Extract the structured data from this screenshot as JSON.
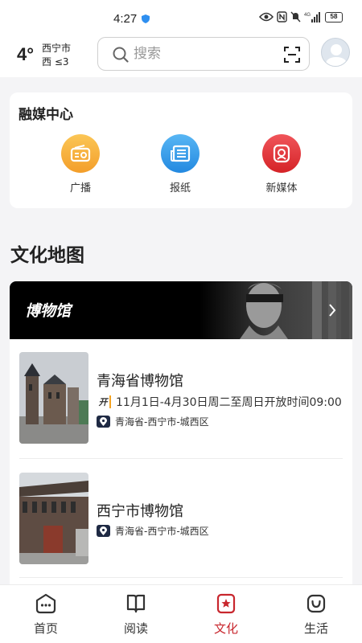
{
  "status_bar": {
    "time": "4:27",
    "battery": "58",
    "network": "4G"
  },
  "header": {
    "temperature": "4°",
    "city": "西宁市",
    "wind": "西 ≤3",
    "search_placeholder": "搜索"
  },
  "media_center": {
    "title": "融媒中心",
    "items": [
      {
        "label": "广播",
        "icon": "radio-icon",
        "color": "#f7b23b"
      },
      {
        "label": "报纸",
        "icon": "newspaper-icon",
        "color": "#2f9be8"
      },
      {
        "label": "新媒体",
        "icon": "new-media-icon",
        "color": "#e23b3b"
      }
    ]
  },
  "culture_map": {
    "title": "文化地图",
    "banner_title": "博物馆",
    "museums": [
      {
        "name": "青海省博物馆",
        "open_badge": "开",
        "hours": "11月1日-4月30日周二至周日开放时间09:00",
        "location": "青海省-西宁市-城西区"
      },
      {
        "name": "西宁市博物馆",
        "location": "青海省-西宁市-城西区"
      }
    ]
  },
  "bottom_nav": {
    "items": [
      {
        "label": "首页",
        "icon": "home-icon",
        "active": false
      },
      {
        "label": "阅读",
        "icon": "book-icon",
        "active": false
      },
      {
        "label": "文化",
        "icon": "culture-icon",
        "active": true
      },
      {
        "label": "生活",
        "icon": "life-icon",
        "active": false
      }
    ]
  },
  "colors": {
    "accent": "#c8262d",
    "background": "#f4f4f6"
  }
}
